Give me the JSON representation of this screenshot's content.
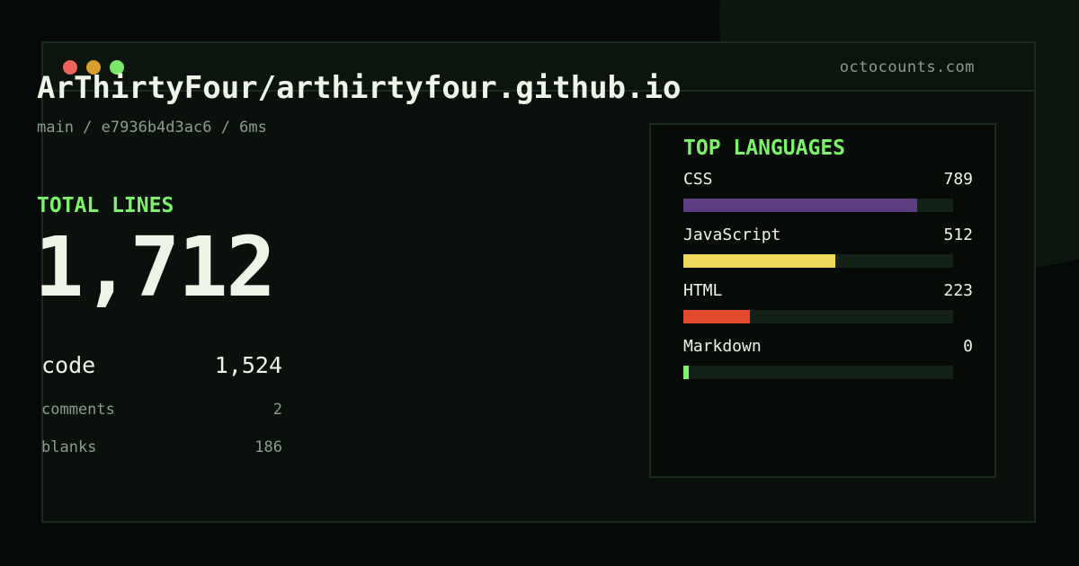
{
  "window": {
    "site": "octocounts.com"
  },
  "repo": {
    "name": "ArThirtyFour/arthirtyfour.github.io",
    "meta": "main / e7936b4d3ac6 / 6ms"
  },
  "totals": {
    "label": "TOTAL LINES",
    "value": "1,712"
  },
  "stats": [
    {
      "label": "code",
      "value": "1,524"
    },
    {
      "label": "comments",
      "value": "2"
    },
    {
      "label": "blanks",
      "value": "186"
    }
  ],
  "languages": {
    "title": "TOP LANGUAGES",
    "items": [
      {
        "name": "CSS",
        "count": "789",
        "fraction": 0.867,
        "color": "#5c3e80"
      },
      {
        "name": "JavaScript",
        "count": "512",
        "fraction": 0.563,
        "color": "#efd85a"
      },
      {
        "name": "HTML",
        "count": "223",
        "fraction": 0.245,
        "color": "#e3492c"
      },
      {
        "name": "Markdown",
        "count": "0",
        "fraction": 0.02,
        "color": "#7cf36a"
      }
    ]
  }
}
